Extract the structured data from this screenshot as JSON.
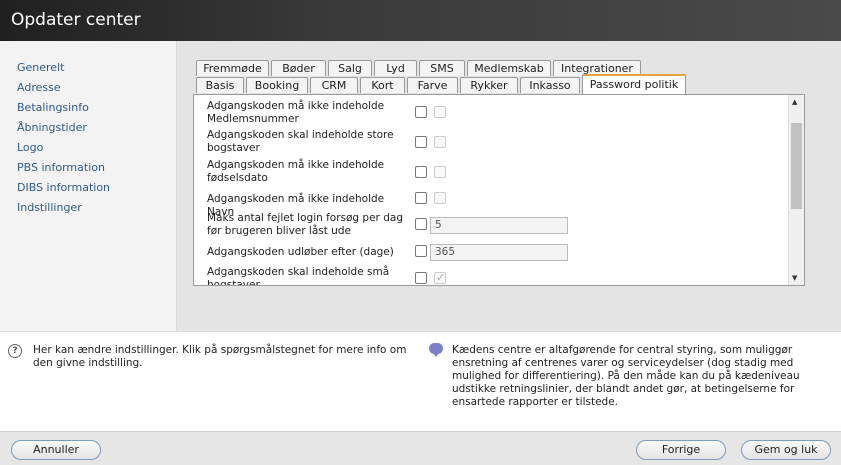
{
  "window": {
    "title": "Opdater center"
  },
  "sidebar": {
    "items": [
      {
        "label": "Generelt"
      },
      {
        "label": "Adresse"
      },
      {
        "label": "Betalingsinfo"
      },
      {
        "label": "Åbningstider"
      },
      {
        "label": "Logo"
      },
      {
        "label": "PBS information"
      },
      {
        "label": "DIBS information"
      },
      {
        "label": "Indstillinger"
      }
    ]
  },
  "tabs": {
    "row1": [
      "Fremmøde",
      "Bøder",
      "Salg",
      "Lyd",
      "SMS",
      "Medlemskab",
      "Integrationer"
    ],
    "row2": [
      "Basis",
      "Booking",
      "CRM",
      "Kort",
      "Farve",
      "Rykker",
      "Inkasso",
      "Password politik"
    ],
    "active": "Password politik"
  },
  "policy": {
    "rows": [
      {
        "label": "Adgangskoden må ikke indeholde Medlemsnummer",
        "checked": false,
        "secondary_checked": false
      },
      {
        "label": "Adgangskoden skal indeholde store bogstaver",
        "checked": false,
        "secondary_checked": false
      },
      {
        "label": "Adgangskoden må ikke indeholde fødselsdato",
        "checked": false,
        "secondary_checked": false
      },
      {
        "label": "Adgangskoden må ikke indeholde Navn",
        "checked": false,
        "secondary_checked": false
      },
      {
        "label": "Maks antal fejlet login forsøg per dag før brugeren bliver låst ude",
        "checked": false,
        "value": "5"
      },
      {
        "label": "Adgangskoden udløber efter (dage)",
        "checked": false,
        "value": "365"
      },
      {
        "label": "Adgangskoden skal indeholde små bogstaver",
        "checked": false,
        "secondary_checked": true
      }
    ]
  },
  "info": {
    "help_text": "Her kan ændre indstillinger. Klik på spørgsmålstegnet for mere info om den givne indstilling.",
    "description": "Kædens centre er altafgørende for central styring, som muliggør ensretning af centrenes varer og serviceydelser (dog stadig med mulighed for differentiering). På den måde kan du på kædeniveau udstikke retningslinier, der blandt andet gør, at betingelserne for ensartede rapporter er tilstede."
  },
  "footer": {
    "cancel_label": "Annuller",
    "prev_label": "Forrige",
    "save_label": "Gem og luk"
  },
  "colors": {
    "active_tab_accent": "#e8a33a",
    "link": "#2e5c8a",
    "button_border": "#7d9bbd"
  }
}
